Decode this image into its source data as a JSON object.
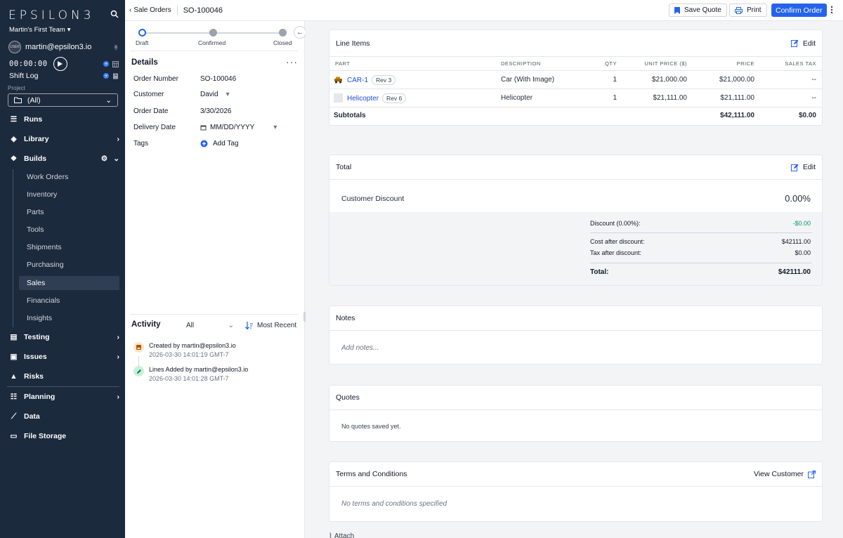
{
  "app": {
    "logo": "EPSILON3",
    "team": "Martin's First Team",
    "user_email": "martin@epsilon3.io",
    "avatar_text": "USER",
    "timer": "00:00:00",
    "shift_log": "Shift Log"
  },
  "project": {
    "label": "Project",
    "value": "(All)"
  },
  "nav": {
    "runs": "Runs",
    "library": "Library",
    "builds": "Builds",
    "builds_sub": [
      "Work Orders",
      "Inventory",
      "Parts",
      "Tools",
      "Shipments",
      "Purchasing",
      "Sales",
      "Financials",
      "Insights"
    ],
    "testing": "Testing",
    "issues": "Issues",
    "risks": "Risks",
    "planning": "Planning",
    "data": "Data",
    "file_storage": "File Storage"
  },
  "topbar": {
    "breadcrumb": "Sale Orders",
    "title": "SO-100046",
    "save_quote": "Save Quote",
    "print": "Print",
    "confirm_order": "Confirm Order"
  },
  "progress": {
    "steps": [
      "Draft",
      "Confirmed",
      "Closed"
    ]
  },
  "details": {
    "title": "Details",
    "order_number_label": "Order Number",
    "order_number": "SO-100046",
    "customer_label": "Customer",
    "customer": "David",
    "order_date_label": "Order Date",
    "order_date": "3/30/2026",
    "delivery_date_label": "Delivery Date",
    "delivery_date_placeholder": "MM/DD/YYYY",
    "tags_label": "Tags",
    "add_tag": "Add Tag"
  },
  "activity": {
    "title": "Activity",
    "filter": "All",
    "sort": "Most Recent",
    "items": [
      {
        "text": "Created by martin@epsilon3.io",
        "time": "2026-03-30 14:01:19 GMT-7"
      },
      {
        "text": "Lines Added by martin@epsilon3.io",
        "time": "2026-03-30 14:01:28 GMT-7"
      }
    ]
  },
  "line_items": {
    "title": "Line Items",
    "edit": "Edit",
    "columns": [
      "PART",
      "DESCRIPTION",
      "QTY",
      "UNIT PRICE ($)",
      "PRICE",
      "SALES TAX"
    ],
    "rows": [
      {
        "part": "CAR-1",
        "rev": "Rev 3",
        "description": "Car (With Image)",
        "qty": "1",
        "unit_price": "$21,000.00",
        "price": "$21,000.00",
        "tax": "--"
      },
      {
        "part": "Helicopter",
        "rev": "Rev 6",
        "description": "Helicopter",
        "qty": "1",
        "unit_price": "$21,111.00",
        "price": "$21,111.00",
        "tax": "--"
      }
    ],
    "subtotal_label": "Subtotals",
    "subtotal_price": "$42,111.00",
    "subtotal_tax": "$0.00"
  },
  "total": {
    "title": "Total",
    "edit": "Edit",
    "discount_label": "Customer Discount",
    "discount_value": "0.00%",
    "discount_line_label": "Discount (0.00%):",
    "discount_line_value": "-$0.00",
    "cost_after_label": "Cost after discount:",
    "cost_after_value": "$42111.00",
    "tax_after_label": "Tax after discount:",
    "tax_after_value": "$0.00",
    "total_label": "Total:",
    "total_value": "$42111.00",
    "discount_color": "#059669"
  },
  "notes": {
    "title": "Notes",
    "placeholder": "Add notes..."
  },
  "quotes": {
    "title": "Quotes",
    "empty": "No quotes saved yet."
  },
  "terms": {
    "title": "Terms and Conditions",
    "view_customer": "View Customer",
    "empty": "No terms and conditions specified"
  },
  "attach": "Attach",
  "colors": {
    "sidebar": "#1c2a3d",
    "accent": "#2563eb"
  }
}
